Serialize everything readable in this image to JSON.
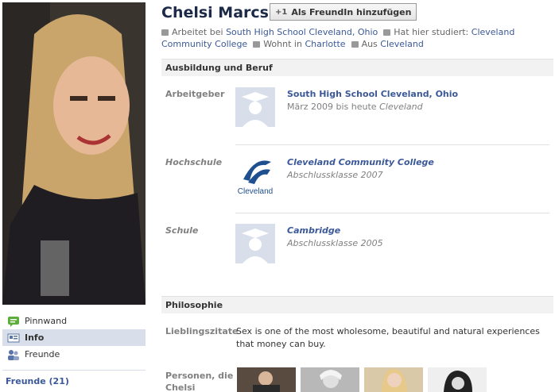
{
  "profile": {
    "name": "Chelsi Marcs",
    "add_friend_label": "Als FreundIn hinzufügen",
    "info_bar": {
      "works_prefix": "Arbeitet bei",
      "works_at": "South High School Cleveland, Ohio",
      "studied_prefix": "Hat hier studiert:",
      "studied_at": "Cleveland Community College",
      "lives_prefix": "Wohnt in",
      "lives_in": "Charlotte",
      "from_prefix": "Aus",
      "from": "Cleveland"
    }
  },
  "sidebar": {
    "items": [
      {
        "label": "Pinnwand",
        "icon": "wall-icon"
      },
      {
        "label": "Info",
        "icon": "info-icon",
        "active": true
      },
      {
        "label": "Freunde",
        "icon": "friends-icon"
      }
    ],
    "friends_heading": "Freunde (21)"
  },
  "education": {
    "heading": "Ausbildung und Beruf",
    "employer": {
      "label": "Arbeitgeber",
      "title": "South High School Cleveland, Ohio",
      "period": "März 2009 bis heute",
      "place": "Cleveland"
    },
    "college": {
      "label": "Hochschule",
      "title": "Cleveland Community College",
      "sub": "Abschlussklasse 2007",
      "logo_text": "Cleveland"
    },
    "school": {
      "label": "Schule",
      "title": "Cambridge",
      "sub": "Abschlussklasse 2005"
    }
  },
  "philosophy": {
    "heading": "Philosophie",
    "quotes_label": "Lieblingszitate",
    "quote": "Sex is one of the most wholesome, beautiful and natural experiences that money can buy.",
    "people_label": "Personen, die Chelsi"
  },
  "colors": {
    "link": "#3b5998",
    "active_nav": "#d8dfea",
    "section_bg": "#f2f2f2"
  }
}
